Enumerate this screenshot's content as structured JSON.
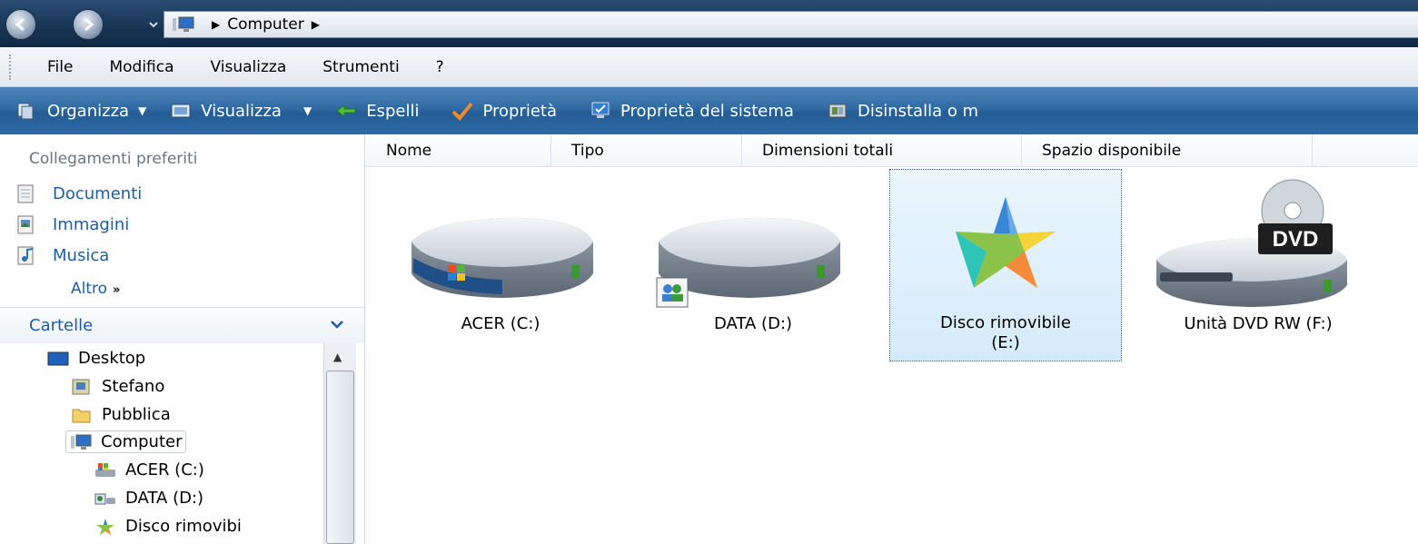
{
  "address_bar": {
    "path": [
      "Computer"
    ]
  },
  "menu": {
    "items": [
      "File",
      "Modifica",
      "Visualizza",
      "Strumenti",
      "?"
    ]
  },
  "toolbar": {
    "organize": "Organizza",
    "views": "Visualizza",
    "eject": "Espelli",
    "properties": "Proprietà",
    "system_properties": "Proprietà del sistema",
    "uninstall": "Disinstalla o m"
  },
  "sidebar": {
    "favorites_title": "Collegamenti preferiti",
    "favorites": [
      "Documenti",
      "Immagini",
      "Musica"
    ],
    "more": "Altro",
    "folders_title": "Cartelle",
    "tree": [
      "Desktop",
      "Stefano",
      "Pubblica",
      "Computer",
      "ACER (C:)",
      "DATA (D:)",
      "Disco rimovibi"
    ]
  },
  "columns": [
    "Nome",
    "Tipo",
    "Dimensioni totali",
    "Spazio disponibile"
  ],
  "drives": [
    {
      "label": "ACER (C:)",
      "icon": "hard-disk-windows-icon"
    },
    {
      "label": "DATA (D:)",
      "icon": "hard-disk-shared-icon"
    },
    {
      "label_line1": "Disco rimovibile",
      "label_line2": "(E:)",
      "icon": "removable-disk-icon",
      "selected": true
    },
    {
      "label": "Unità DVD RW (F:)",
      "icon": "dvd-drive-icon"
    }
  ]
}
